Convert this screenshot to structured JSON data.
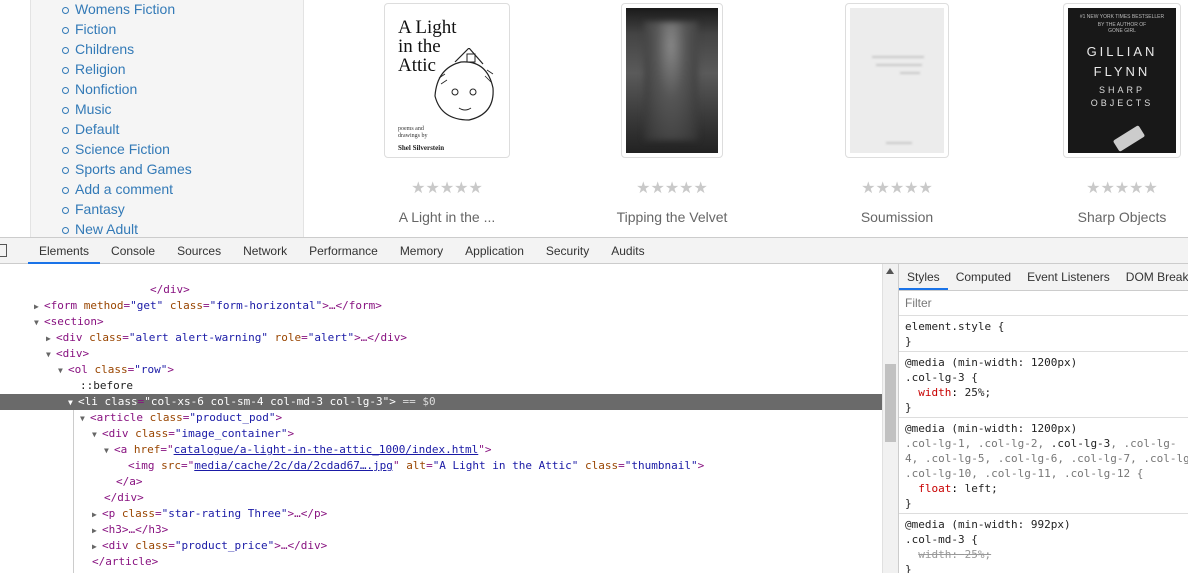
{
  "sidebar": {
    "categories": [
      "Womens Fiction",
      "Fiction",
      "Childrens",
      "Religion",
      "Nonfiction",
      "Music",
      "Default",
      "Science Fiction",
      "Sports and Games",
      "Add a comment",
      "Fantasy",
      "New Adult"
    ]
  },
  "books": [
    {
      "title": "A Light in the ...",
      "stars": "★★★★★",
      "cover": {
        "title_line1": "A Light",
        "title_line2": "in the",
        "title_line3": "Attic",
        "subtitle1": "poems and",
        "subtitle2": "drawings by",
        "author": "Shel Silverstein"
      }
    },
    {
      "title": "Tipping the Velvet",
      "stars": "★★★★★"
    },
    {
      "title": "Soumission",
      "stars": "★★★★★"
    },
    {
      "title": "Sharp Objects",
      "stars": "★★★★★",
      "cover": {
        "tag1": "#1 NEW YORK TIMES BESTSELLER",
        "tag2": "BY THE AUTHOR OF",
        "tag3": "GONE GIRL",
        "author1": "GILLIAN",
        "author2": "FLYNN",
        "title1": "SHARP",
        "title2": "OBJECTS"
      }
    }
  ],
  "devtools": {
    "tabs": [
      "Elements",
      "Console",
      "Sources",
      "Network",
      "Performance",
      "Memory",
      "Application",
      "Security",
      "Audits"
    ],
    "active_tab": "Elements",
    "dom": {
      "l1": "</div>",
      "l2_open": "<form",
      "l2_a1": "method",
      "l2_v1": "\"get\"",
      "l2_a2": "class",
      "l2_v2": "\"form-horizontal\"",
      "l2_close": ">…</form>",
      "l3": "<section>",
      "l4_open": "<div",
      "l4_a1": "class",
      "l4_v1": "\"alert alert-warning\"",
      "l4_a2": "role",
      "l4_v2": "\"alert\"",
      "l4_close": ">…</div>",
      "l5": "<div>",
      "l6_open": "<ol",
      "l6_a1": "class",
      "l6_v1": "\"row\"",
      "l6_close": ">",
      "l7": "::before",
      "l8_open": "<li",
      "l8_a1": "class",
      "l8_v1": "\"col-xs-6 col-sm-4 col-md-3 col-lg-3\"",
      "l8_close": ">",
      "l8_eq": " == $0",
      "l9_open": "<article",
      "l9_a1": "class",
      "l9_v1": "\"product_pod\"",
      "l9_close": ">",
      "l10_open": "<div",
      "l10_a1": "class",
      "l10_v1": "\"image_container\"",
      "l10_close": ">",
      "l11_open": "<a",
      "l11_a1": "href",
      "l11_v1": "catalogue/a-light-in-the-attic_1000/index.html",
      "l11_close": ">",
      "l12_open": "<img",
      "l12_a1": "src",
      "l12_v1": "media/cache/2c/da/2cdad67….jpg",
      "l12_a2": "alt",
      "l12_v2": "\"A Light in the Attic\"",
      "l12_a3": "class",
      "l12_v3": "\"thumbnail\"",
      "l12_close": ">",
      "l13": "</a>",
      "l14": "</div>",
      "l15_open": "<p",
      "l15_a1": "class",
      "l15_v1": "\"star-rating Three\"",
      "l15_close": ">…</p>",
      "l16": "<h3>…</h3>",
      "l17_open": "<div",
      "l17_a1": "class",
      "l17_v1": "\"product_price\"",
      "l17_close": ">…</div>",
      "l18": "</article>"
    },
    "styles_tabs": [
      "Styles",
      "Computed",
      "Event Listeners",
      "DOM Breakpoints"
    ],
    "filter_placeholder": "Filter",
    "rules": {
      "r1_sel": "element.style {",
      "r1_end": "}",
      "r2_media": "@media (min-width: 1200px)",
      "r2_sel": ".col-lg-3 {",
      "r2_prop": "width",
      "r2_val": "25%;",
      "r2_end": "}",
      "r3_media": "@media (min-width: 1200px)",
      "r3_sel_a": ".col-lg-1, .col-lg-2, ",
      "r3_sel_b": ".col-lg-3",
      "r3_sel_c": ", .col-lg-",
      "r3_sel_d": "4, .col-lg-5, .col-lg-6, .col-lg-7, .col-lg",
      "r3_sel_e": ".col-lg-10, .col-lg-11, .col-lg-12 {",
      "r3_prop": "float",
      "r3_val": "left;",
      "r3_end": "}",
      "r4_media": "@media (min-width: 992px)",
      "r4_sel": ".col-md-3 {",
      "r4_prop": "width",
      "r4_val": "25%;",
      "r4_end": "}"
    }
  }
}
